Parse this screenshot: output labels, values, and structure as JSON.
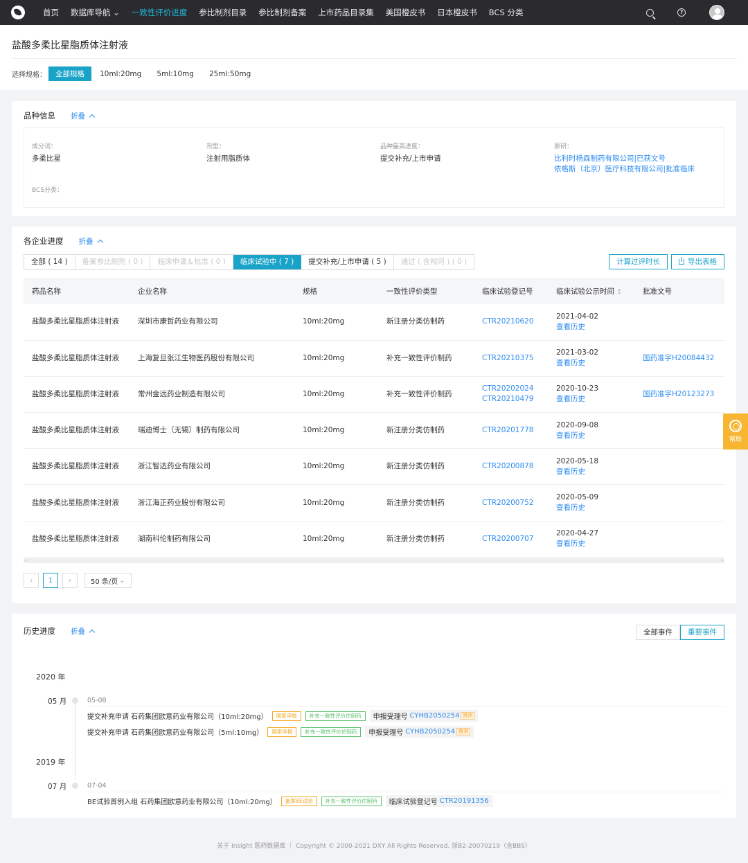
{
  "nav": {
    "items": [
      {
        "label": "首页",
        "active": false
      },
      {
        "label": "数据库导航 ⌄",
        "active": false
      },
      {
        "label": "一致性评价进度",
        "active": true
      },
      {
        "label": "参比制剂目录",
        "active": false
      },
      {
        "label": "参比制剂备案",
        "active": false
      },
      {
        "label": "上市药品目录集",
        "active": false
      },
      {
        "label": "美国橙皮书",
        "active": false
      },
      {
        "label": "日本橙皮书",
        "active": false
      },
      {
        "label": "BCS 分类",
        "active": false
      }
    ]
  },
  "page": {
    "title": "盐酸多柔比星脂质体注射液",
    "spec_label": "选择规格：",
    "specs": [
      "全部规格",
      "10ml:20mg",
      "5ml:10mg",
      "25ml:50mg"
    ]
  },
  "variety": {
    "title": "品种信息",
    "fold_label": "折叠",
    "fields": {
      "ingredient_label": "成分词：",
      "ingredient": "多柔比星",
      "dosage_label": "剂型：",
      "dosage": "注射用脂质体",
      "progress_label": "品种最高进度：",
      "progress": "提交补充/上市申请",
      "original_label": "原研：",
      "original_1": "比利时杨森制药有限公司|已获文号",
      "original_2": "依格斯（北京）医疗科技有限公司|批准临床",
      "bcs_label": "BCS分类："
    }
  },
  "companies": {
    "title": "各企业进度",
    "fold_label": "折叠",
    "tabs": [
      {
        "label": "全部 ( 14 )",
        "state": "normal"
      },
      {
        "label": "备案参比制剂 ( 0 )",
        "state": "disabled"
      },
      {
        "label": "临床申请＆批准 ( 0 )",
        "state": "disabled"
      },
      {
        "label": "临床试验中 ( 7 )",
        "state": "active"
      },
      {
        "label": "提交补充/上市申请 ( 5 )",
        "state": "normal"
      },
      {
        "label": "通过 ( 含视同 ) ( 0 )",
        "state": "disabled"
      }
    ],
    "calc_button": "计算过评时长",
    "export_button": "导出表格",
    "columns": [
      "药品名称",
      "企业名称",
      "规格",
      "一致性评价类型",
      "临床试验登记号",
      "临床试验公示时间",
      "批准文号"
    ],
    "rows": [
      {
        "drug": "盐酸多柔比星脂质体注射液",
        "company": "深圳市康哲药业有限公司",
        "spec": "10ml:20mg",
        "type": "新注册分类仿制药",
        "reg1": "CTR20210620",
        "reg2": "",
        "date": "2021-04-02",
        "history": "查看历史",
        "approval": ""
      },
      {
        "drug": "盐酸多柔比星脂质体注射液",
        "company": "上海复旦张江生物医药股份有限公司",
        "spec": "10ml:20mg",
        "type": "补充一致性评价制药",
        "reg1": "CTR20210375",
        "reg2": "",
        "date": "2021-03-02",
        "history": "查看历史",
        "approval": "国药准字H20084432"
      },
      {
        "drug": "盐酸多柔比星脂质体注射液",
        "company": "常州金远药业制造有限公司",
        "spec": "10ml:20mg",
        "type": "补充一致性评价制药",
        "reg1": "CTR20202024",
        "reg2": "CTR20210479",
        "date": "2020-10-23",
        "history": "查看历史",
        "approval": "国药准字H20123273"
      },
      {
        "drug": "盐酸多柔比星脂质体注射液",
        "company": "瑞迪博士（无锡）制药有限公司",
        "spec": "10ml:20mg",
        "type": "新注册分类仿制药",
        "reg1": "CTR20201778",
        "reg2": "",
        "date": "2020-09-08",
        "history": "查看历史",
        "approval": ""
      },
      {
        "drug": "盐酸多柔比星脂质体注射液",
        "company": "浙江智达药业有限公司",
        "spec": "10ml:20mg",
        "type": "新注册分类仿制药",
        "reg1": "CTR20200878",
        "reg2": "",
        "date": "2020-05-18",
        "history": "查看历史",
        "approval": ""
      },
      {
        "drug": "盐酸多柔比星脂质体注射液",
        "company": "浙江海正药业股份有限公司",
        "spec": "10ml:20mg",
        "type": "新注册分类仿制药",
        "reg1": "CTR20200752",
        "reg2": "",
        "date": "2020-05-09",
        "history": "查看历史",
        "approval": ""
      },
      {
        "drug": "盐酸多柔比星脂质体注射液",
        "company": "湖南科伦制药有限公司",
        "spec": "10ml:20mg",
        "type": "新注册分类仿制药",
        "reg1": "CTR20200707",
        "reg2": "",
        "date": "2020-04-27",
        "history": "查看历史",
        "approval": ""
      }
    ],
    "pager": {
      "current": "1",
      "page_size": "50 条/页",
      "prev": "‹",
      "next": "›"
    }
  },
  "history": {
    "title": "历史进度",
    "fold_label": "折叠",
    "all_events": "全部事件",
    "important_events": "重要事件",
    "groups": [
      {
        "year": "2020 年",
        "month": "05 月",
        "date": "05-08",
        "events": [
          {
            "text": "提交补充申请 石药集团欧意药业有限公司（10ml:20mg）",
            "tag1": "国家申报",
            "tag2": "补充一致性评价仿制药",
            "reg_label": "申报受理号",
            "reg_no": "CYHB2050254",
            "flag": "推测"
          },
          {
            "text": "提交补充申请 石药集团欧意药业有限公司（5ml:10mg）",
            "tag1": "国家申报",
            "tag2": "补充一致性评价仿制药",
            "reg_label": "申报受理号",
            "reg_no": "CYHB2050254",
            "flag": "推测"
          }
        ]
      },
      {
        "year": "2019 年",
        "month": "07 月",
        "date": "07-04",
        "events": [
          {
            "text": "BE试验首例入组 石药集团欧意药业有限公司（10ml:20mg）",
            "tag1": "备案BE试验",
            "tag2": "补充一致性评价仿制药",
            "reg_label": "临床试验登记号",
            "reg_no": "CTR20191356",
            "flag": ""
          }
        ]
      }
    ]
  },
  "help_label": "帮助",
  "footer": "关于 Insight 医药数据库 ｜ Copyright © 2000-2021 DXY All Rights Reserved. 浙B2-20070219（含BBS）"
}
